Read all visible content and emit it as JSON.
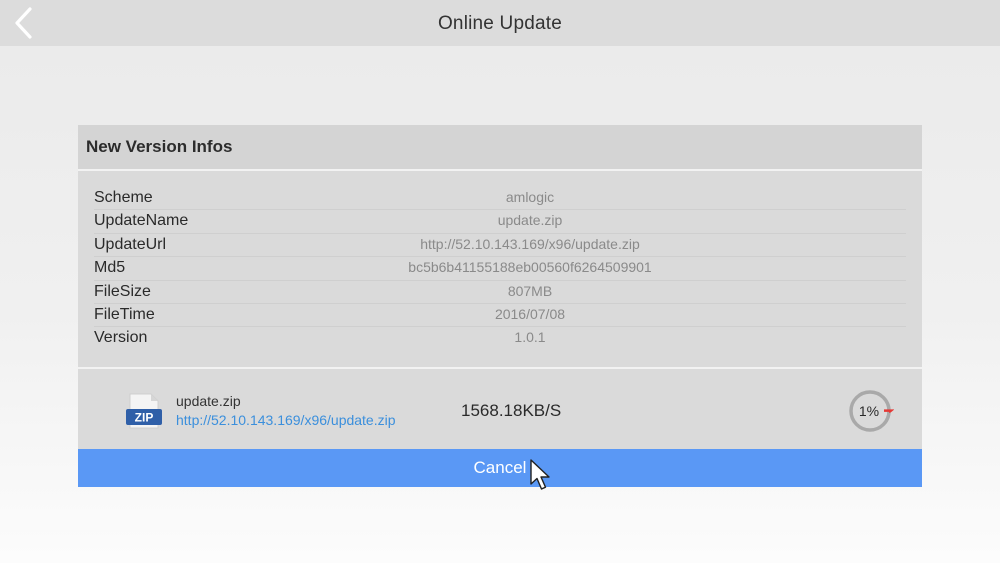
{
  "header": {
    "title": "Online Update",
    "back_icon": "chevron-left-icon"
  },
  "card": {
    "title": "New Version Infos",
    "info": [
      {
        "label": "Scheme",
        "value": "amlogic"
      },
      {
        "label": "UpdateName",
        "value": "update.zip"
      },
      {
        "label": "UpdateUrl",
        "value": "http://52.10.143.169/x96/update.zip"
      },
      {
        "label": "Md5",
        "value": "bc5b6b41155188eb00560f6264509901"
      },
      {
        "label": "FileSize",
        "value": "807MB"
      },
      {
        "label": "FileTime",
        "value": "2016/07/08"
      },
      {
        "label": "Version",
        "value": "1.0.1"
      }
    ],
    "download": {
      "file_icon_label": "ZIP",
      "file_name": "update.zip",
      "file_url": "http://52.10.143.169/x96/update.zip",
      "speed": "1568.18KB/S",
      "progress_text": "1%",
      "progress_fraction": 0.01
    },
    "cancel_label": "Cancel"
  },
  "colors": {
    "accent_blue": "#5a98f5",
    "link_blue": "#3b8fdc",
    "progress_red": "#e53935",
    "progress_track": "#a9a9a9"
  }
}
